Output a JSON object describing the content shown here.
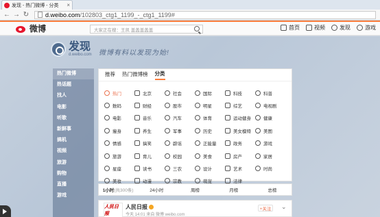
{
  "browser": {
    "tab_title": "发现 - 热门微博 - 分类",
    "url_host": "d.weibo.com",
    "url_path": "/102803_ctg1_1199_-_ctg1_1199#"
  },
  "header": {
    "logo_text": "微博",
    "search_placeholder": "大家正在搜：王凯 盖盖盖盖盖",
    "menu": [
      {
        "label": "首页",
        "icon": "home-icon"
      },
      {
        "label": "视频",
        "icon": "video-icon"
      },
      {
        "label": "发现",
        "icon": "discover-icon"
      },
      {
        "label": "游戏",
        "icon": "game-icon"
      }
    ]
  },
  "discover": {
    "title": "发现",
    "subtitle": "d.weibo.com",
    "slogan": "微博有料以发现为始!"
  },
  "sidebar": {
    "items": [
      "热门微博",
      "热话题",
      "找人",
      "电影",
      "听歌",
      "新鲜事",
      "搞机",
      "视频",
      "旅游",
      "购物",
      "直播",
      "游戏"
    ]
  },
  "tabs": [
    "推荐",
    "热门微博榜",
    "分类"
  ],
  "categories": [
    "热门",
    "北京",
    "社会",
    "国际",
    "科技",
    "科普",
    "数码",
    "财经",
    "股市",
    "明星",
    "综艺",
    "电视剧",
    "电影",
    "音乐",
    "汽车",
    "体育",
    "运动健身",
    "健康",
    "瘦身",
    "养生",
    "军事",
    "历史",
    "美女模特",
    "美图",
    "情感",
    "搞笑",
    "辟谣",
    "正能量",
    "政务",
    "游戏",
    "旅游",
    "育儿",
    "校园",
    "美食",
    "房产",
    "家居",
    "星座",
    "读书",
    "三农",
    "设计",
    "艺术",
    "时尚",
    "美妆",
    "动漫",
    "宗教",
    "萌宠",
    "法律"
  ],
  "time_tabs": [
    {
      "label": "1小时",
      "count": "(共300条)"
    },
    {
      "label": "24小时",
      "count": ""
    },
    {
      "label": "周榜",
      "count": ""
    },
    {
      "label": "月榜",
      "count": ""
    },
    {
      "label": "总榜",
      "count": ""
    }
  ],
  "feed": {
    "avatar_text": "人民日报",
    "user": "人民日报",
    "meta": "今天 14:01 来自 微博 weibo.com",
    "follow": "+关注"
  },
  "colors": {
    "accent": "#fa7d3c",
    "brand": "#e6162d",
    "hot": "#eb7350"
  }
}
